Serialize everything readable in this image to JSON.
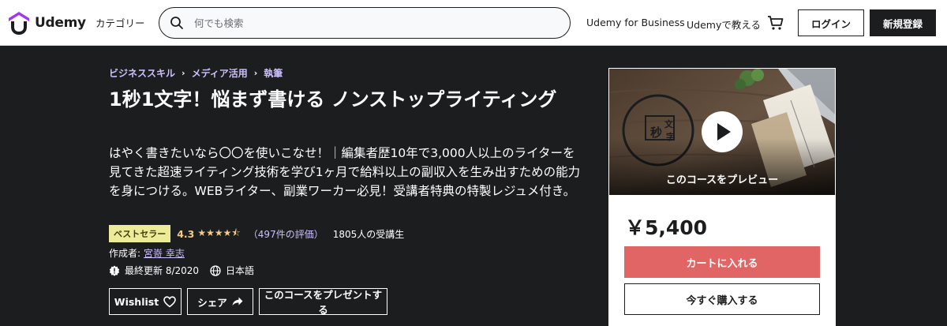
{
  "header": {
    "logo_text": "Udemy",
    "categories_label": "カテゴリー",
    "search_placeholder": "何でも検索",
    "business_label": "Udemy for Business",
    "teach_label": "Udemyで教える",
    "login_label": "ログイン",
    "signup_label": "新規登録"
  },
  "breadcrumb": [
    "ビジネススキル",
    "メディア活用",
    "執筆"
  ],
  "course": {
    "title": "1秒1文字！悩まず書ける ノンストップライティング",
    "subtitle": "はやく書きたいなら〇〇を使いこなせ！｜編集者歴10年で3,000人以上のライターを見てきた超速ライティング技術を学び1ヶ月で給料以上の副収入を生み出すための能力を身につける。WEBライター、副業ワーカー必見！受講者特典の特製レジュメ付き。",
    "badge": "ベストセラー",
    "rating": "4.3",
    "rating_stars": 4.3,
    "rating_count": "（497件の評価）",
    "students": "1805人の受講生",
    "author_prefix": "作成者:",
    "author_name": "宮嵜 幸志",
    "last_updated": "最終更新 8/2020",
    "language": "日本語"
  },
  "actions": {
    "wishlist_label": "Wishlist",
    "share_label": "シェア",
    "gift_label": "このコースをプレゼントする"
  },
  "sidebar": {
    "preview_label": "このコースをプレビュー",
    "price": "￥5,400",
    "cart_label": "カートに入れる",
    "buy_label": "今すぐ購入する"
  },
  "colors": {
    "brand_red": "#a435f0",
    "hero_bg": "#1c1d1f",
    "cart_button": "#e26565",
    "star": "#f3ca8c",
    "badge_bg": "#eceb98",
    "link": "#cec0fc"
  }
}
